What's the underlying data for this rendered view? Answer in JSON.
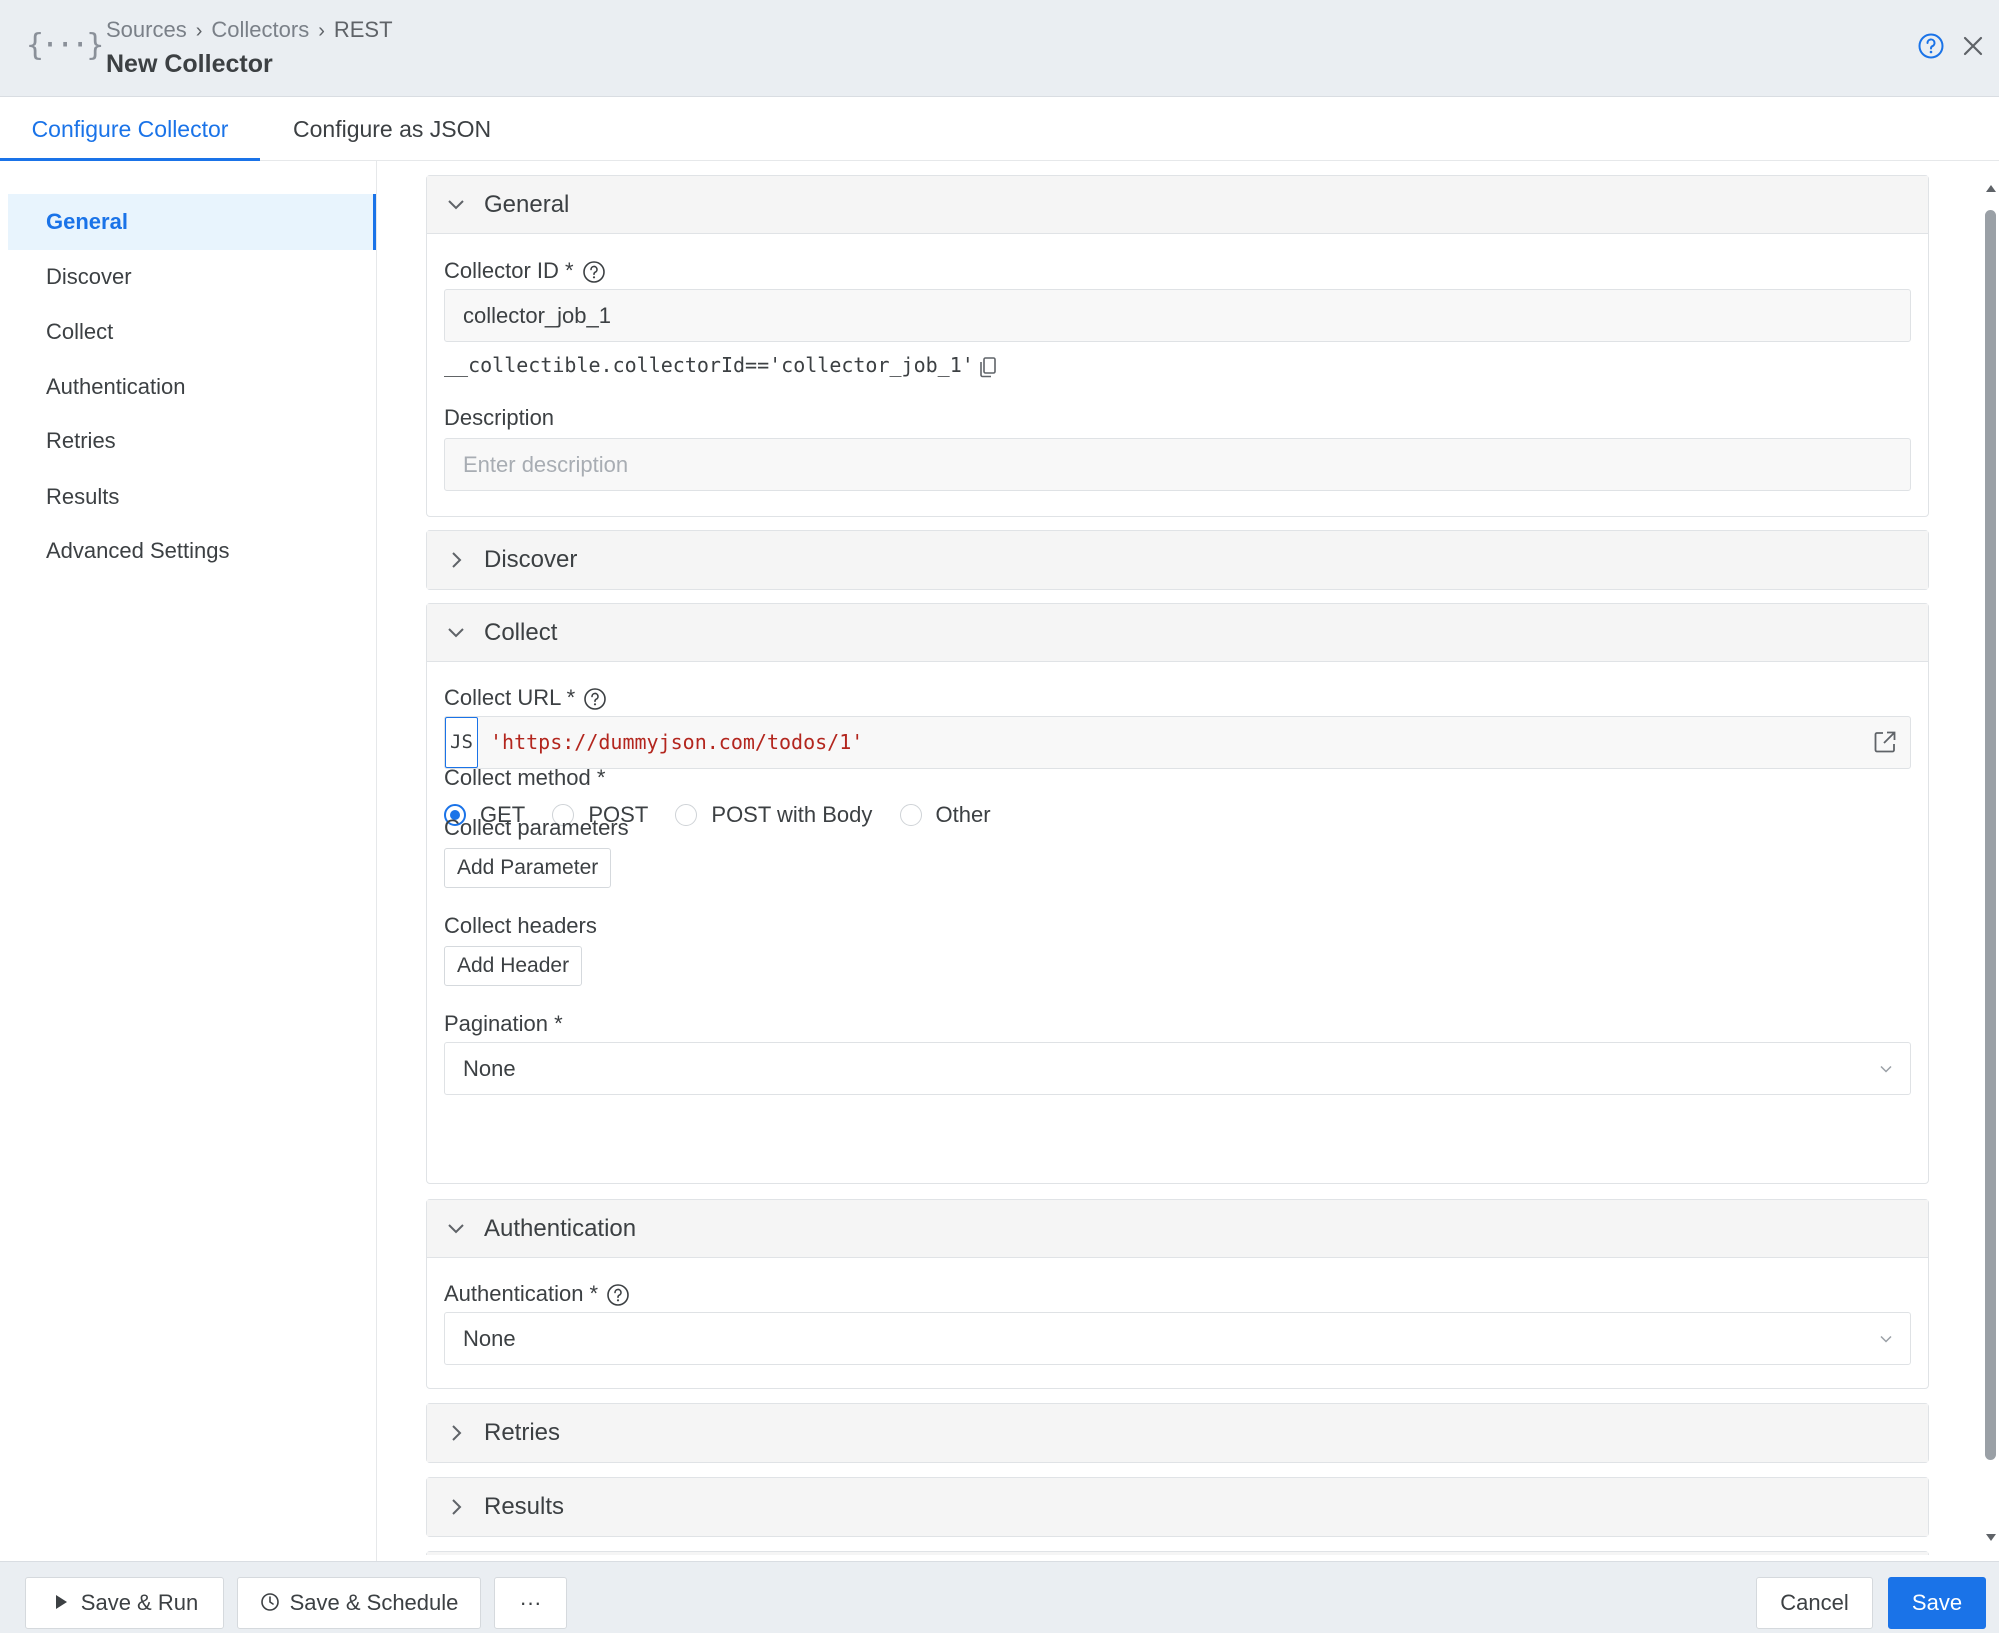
{
  "header": {
    "logo_glyph": "{···}",
    "breadcrumb": [
      "Sources",
      "Collectors",
      "REST"
    ],
    "breadcrumb_sep": "›",
    "title": "New Collector"
  },
  "tabs": [
    {
      "label": "Configure Collector",
      "active": true
    },
    {
      "label": "Configure as JSON",
      "active": false
    }
  ],
  "sidenav": {
    "items": [
      {
        "label": "General",
        "active": true
      },
      {
        "label": "Discover",
        "active": false
      },
      {
        "label": "Collect",
        "active": false
      },
      {
        "label": "Authentication",
        "active": false
      },
      {
        "label": "Retries",
        "active": false
      },
      {
        "label": "Results",
        "active": false
      },
      {
        "label": "Advanced Settings",
        "active": false
      }
    ]
  },
  "general": {
    "title": "General",
    "expanded": true,
    "collector_id_label": "Collector ID *",
    "collector_id_value": "collector_job_1",
    "collectible_expr": "__collectible.collectorId=='collector_job_1'",
    "description_label": "Description",
    "description_placeholder": "Enter description"
  },
  "discover": {
    "title": "Discover",
    "expanded": false
  },
  "collect": {
    "title": "Collect",
    "expanded": true,
    "url_label": "Collect URL *",
    "url_badge": "JS",
    "url_value": "'https://dummyjson.com/todos/1'",
    "method_label": "Collect method *",
    "methods": [
      {
        "label": "GET",
        "selected": true
      },
      {
        "label": "POST",
        "selected": false
      },
      {
        "label": "POST with Body",
        "selected": false
      },
      {
        "label": "Other",
        "selected": false
      }
    ],
    "params_label": "Collect parameters",
    "add_param_label": "Add Parameter",
    "headers_label": "Collect headers",
    "add_header_label": "Add Header",
    "pagination_label": "Pagination *",
    "pagination_value": "None"
  },
  "authentication": {
    "title": "Authentication",
    "expanded": true,
    "auth_label": "Authentication *",
    "auth_value": "None"
  },
  "retries": {
    "title": "Retries",
    "expanded": false
  },
  "results": {
    "title": "Results",
    "expanded": false
  },
  "footer": {
    "save_run_label": "Save & Run",
    "save_schedule_label": "Save & Schedule",
    "more_label": "···",
    "cancel_label": "Cancel",
    "save_label": "Save"
  },
  "colors": {
    "accent": "#1a73e8",
    "header_bg": "#eaeef2",
    "section_head_bg": "#f5f5f5",
    "url_string": "#b3261e"
  }
}
